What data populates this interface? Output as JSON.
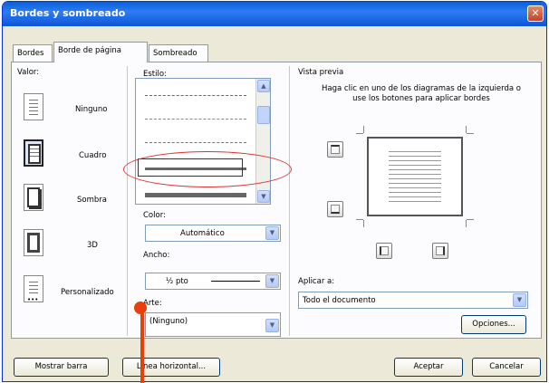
{
  "window": {
    "title": "Bordes y sombreado",
    "close_icon": "close-icon"
  },
  "tabs": [
    {
      "label": "Bordes",
      "active": false
    },
    {
      "label": "Borde de página",
      "active": true
    },
    {
      "label": "Sombreado",
      "active": false
    }
  ],
  "setting": {
    "label": "Valor:",
    "options": [
      {
        "label": "Ninguno",
        "selected": false
      },
      {
        "label": "Cuadro",
        "selected": true
      },
      {
        "label": "Sombra",
        "selected": false
      },
      {
        "label": "3D",
        "selected": false
      },
      {
        "label": "Personalizado",
        "selected": false
      }
    ]
  },
  "style": {
    "label": "Estilo:"
  },
  "color": {
    "label": "Color:",
    "value": "Automático"
  },
  "width": {
    "label": "Ancho:",
    "value": "½ pto"
  },
  "art": {
    "label": "Arte:",
    "value": "(Ninguno)"
  },
  "preview": {
    "label": "Vista previa",
    "hint": "Haga clic en uno de los diagramas de la izquierda o use los botones para aplicar bordes"
  },
  "apply_to": {
    "label": "Aplicar a:",
    "value": "Todo el documento"
  },
  "buttons": {
    "options": "Opciones...",
    "show_toolbar": "Mostrar barra",
    "horizontal_line": "Línea horizontal...",
    "ok": "Aceptar",
    "cancel": "Cancelar"
  },
  "colors": {
    "annotation_red": "#e03030",
    "pointer_orange": "#e8400c",
    "title_blue": "#0a5fd8"
  }
}
